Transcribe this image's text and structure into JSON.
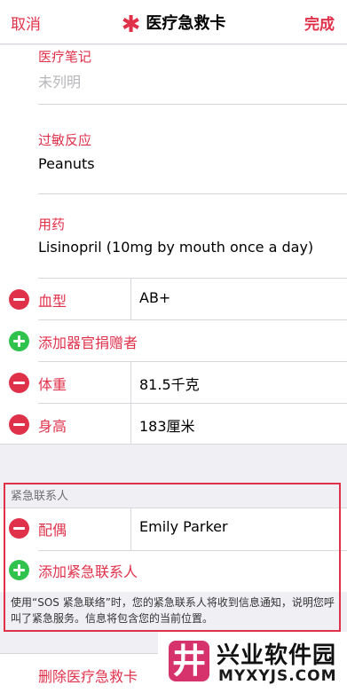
{
  "navbar": {
    "cancel": "取消",
    "title": "医疗急救卡",
    "done": "完成",
    "star": "✱"
  },
  "medical_notes": {
    "label": "医疗笔记",
    "value": "未列明"
  },
  "allergies": {
    "label": "过敏反应",
    "value": "Peanuts"
  },
  "medications": {
    "label": "用药",
    "value": "Lisinopril (10mg by mouth once a day)"
  },
  "rows": {
    "blood_type": {
      "label": "血型",
      "value": "AB+"
    },
    "organ_donor": {
      "label": "添加器官捐赠者"
    },
    "weight": {
      "label": "体重",
      "value": "81.5千克"
    },
    "height": {
      "label": "身高",
      "value": "183厘米"
    }
  },
  "emergency": {
    "header": "紧急联系人",
    "contact_relation": "配偶",
    "contact_name": "Emily Parker",
    "add_label": "添加紧急联系人",
    "note": "使用“SOS 紧急联络”时，您的紧急联系人将收到信息通知，说明您呼叫了紧急服务。信息将包含您的当前位置。"
  },
  "delete_label": "删除医疗急救卡",
  "watermark": {
    "name": "兴业软件园",
    "url": "MYXYJS.COM",
    "glyph": "井"
  },
  "colors": {
    "accent": "#e0314b",
    "add_green": "#2fc24c",
    "background": "#efeff4"
  }
}
